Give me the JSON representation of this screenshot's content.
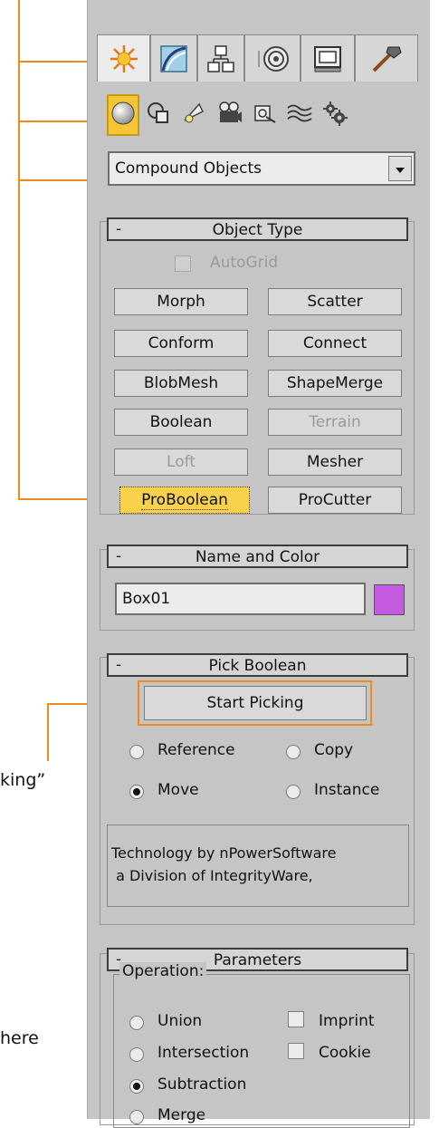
{
  "callouts": {
    "pick_text": "king”",
    "here_text": "here"
  },
  "tabs": [
    {
      "name": "create",
      "icon": "sun-icon",
      "active": true
    },
    {
      "name": "modify",
      "icon": "curve-icon",
      "active": false
    },
    {
      "name": "hierarchy",
      "icon": "hierarchy-icon",
      "active": false
    },
    {
      "name": "motion",
      "icon": "motion-icon",
      "active": false
    },
    {
      "name": "display",
      "icon": "display-icon",
      "active": false
    },
    {
      "name": "utilities",
      "icon": "hammer-icon",
      "active": false
    }
  ],
  "categories": [
    {
      "name": "geometry",
      "icon": "sphere-icon",
      "active": true
    },
    {
      "name": "shapes",
      "icon": "shapes-icon"
    },
    {
      "name": "lights",
      "icon": "light-icon"
    },
    {
      "name": "cameras",
      "icon": "camera-icon"
    },
    {
      "name": "helpers",
      "icon": "helper-icon"
    },
    {
      "name": "spacewarps",
      "icon": "spacewarp-icon"
    },
    {
      "name": "systems",
      "icon": "gears-icon"
    }
  ],
  "dropdown": {
    "value": "Compound Objects"
  },
  "object_type": {
    "title": "Object Type",
    "collapse": "-",
    "autogrid_label": "AutoGrid",
    "buttons": [
      {
        "label": "Morph",
        "state": "normal"
      },
      {
        "label": "Scatter",
        "state": "normal"
      },
      {
        "label": "Conform",
        "state": "normal"
      },
      {
        "label": "Connect",
        "state": "normal"
      },
      {
        "label": "BlobMesh",
        "state": "normal"
      },
      {
        "label": "ShapeMerge",
        "state": "normal"
      },
      {
        "label": "Boolean",
        "state": "normal"
      },
      {
        "label": "Terrain",
        "state": "disabled"
      },
      {
        "label": "Loft",
        "state": "disabled"
      },
      {
        "label": "Mesher",
        "state": "normal"
      },
      {
        "label": "ProBoolean",
        "state": "active"
      },
      {
        "label": "ProCutter",
        "state": "normal"
      }
    ]
  },
  "name_color": {
    "title": "Name and Color",
    "collapse": "-",
    "name_value": "Box01",
    "color": "#c35ae0"
  },
  "pick_boolean": {
    "title": "Pick Boolean",
    "collapse": "-",
    "start_label": "Start Picking",
    "radios": [
      {
        "label": "Reference",
        "checked": false
      },
      {
        "label": "Copy",
        "checked": false
      },
      {
        "label": "Move",
        "checked": true
      },
      {
        "label": "Instance",
        "checked": false
      }
    ],
    "tech_line1": "Technology by nPowerSoftware",
    "tech_line2": " a Division of IntegrityWare,"
  },
  "parameters": {
    "title": "Parameters",
    "collapse": "-",
    "operation_label": "Operation:",
    "operations": [
      {
        "label": "Union",
        "checked": false
      },
      {
        "label": "Intersection",
        "checked": false
      },
      {
        "label": "Subtraction",
        "checked": true
      },
      {
        "label": "Merge",
        "checked": false
      }
    ],
    "imprint_label": "Imprint",
    "cookie_label": "Cookie"
  },
  "colors": {
    "accent": "#f08a1c",
    "active": "#f5c537",
    "panel": "#c5c5c5"
  }
}
